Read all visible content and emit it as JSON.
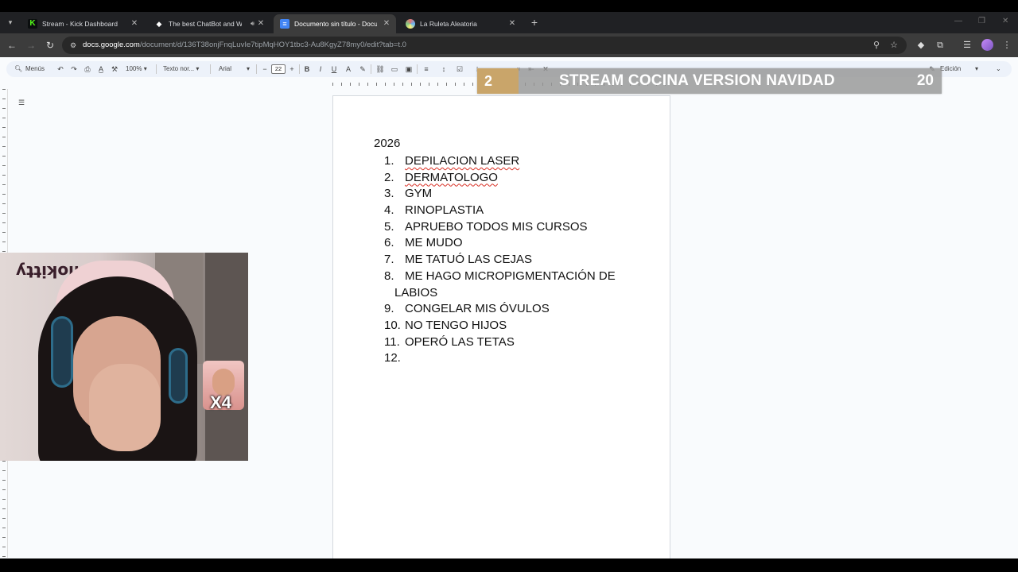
{
  "browser": {
    "tabs": [
      {
        "title": "Stream - Kick Dashboard",
        "favicon_color": "#53fc18",
        "favicon_letter": "K",
        "active": false
      },
      {
        "title": "The best ChatBot and Widg",
        "favicon_color": "#ffffff",
        "favicon_letter": "◆",
        "active": false,
        "audio": true
      },
      {
        "title": "Documento sin título - Docum",
        "favicon_color": "#4285f4",
        "favicon_letter": "≡",
        "active": true
      },
      {
        "title": "La Ruleta Aleatoria",
        "favicon_color": "#e8a0b4",
        "favicon_letter": "●",
        "active": false
      }
    ],
    "url_host": "docs.google.com",
    "url_path": "/document/d/136T38onjFnqLuvIe7tipMqHOY1tbc3-Au8KgyZ78my0/edit?tab=t.0"
  },
  "toolbar": {
    "menus_label": "Menús",
    "zoom": "100%",
    "style": "Texto nor...",
    "font": "Arial",
    "font_size": "22",
    "mode": "Edición"
  },
  "document": {
    "heading": "2026",
    "items": [
      {
        "num": "1.",
        "text": "DEPILACION LASER",
        "spell": true
      },
      {
        "num": "2.",
        "text": "DERMATOLOGO",
        "spell": true
      },
      {
        "num": "3.",
        "text": "GYM"
      },
      {
        "num": "4.",
        "text": "RINOPLASTIA"
      },
      {
        "num": "5.",
        "text": "APRUEBO TODOS MIS CURSOS"
      },
      {
        "num": "6.",
        "text": "ME MUDO"
      },
      {
        "num": "7.",
        "text": "ME TATUÓ LAS CEJAS"
      },
      {
        "num": "8.",
        "text": "ME HAGO MICROPIGMENTACIÓN DE",
        "cont": "LABIOS"
      },
      {
        "num": "9.",
        "text": "CONGELAR MIS ÓVULOS"
      },
      {
        "num": "10.",
        "text": "NO TENGO HIJOS"
      },
      {
        "num": "11.",
        "text": "OPERÓ LAS TETAS"
      },
      {
        "num": "12.",
        "text": ""
      }
    ]
  },
  "overlay": {
    "left_number": "2",
    "title": "STREAM COCINA VERSION NAVIDAD",
    "right_number": "20"
  },
  "webcam": {
    "sticker_text": "ellokitty",
    "multiplier": "X4"
  }
}
